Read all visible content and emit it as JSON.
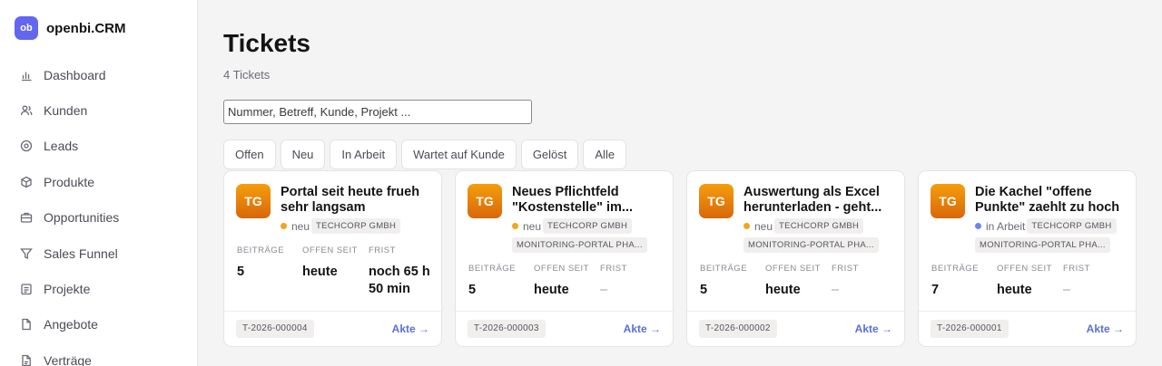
{
  "brand": {
    "logo": "ob",
    "name": "openbi.CRM",
    "color": "#6366f1"
  },
  "nav": [
    {
      "icon": "bar-chart-icon",
      "label": "Dashboard"
    },
    {
      "icon": "users-icon",
      "label": "Kunden"
    },
    {
      "icon": "target-icon",
      "label": "Leads"
    },
    {
      "icon": "box-icon",
      "label": "Produkte"
    },
    {
      "icon": "briefcase-icon",
      "label": "Opportunities"
    },
    {
      "icon": "funnel-icon",
      "label": "Sales Funnel"
    },
    {
      "icon": "clipboard-icon",
      "label": "Projekte"
    },
    {
      "icon": "document-icon",
      "label": "Angebote"
    },
    {
      "icon": "contract-icon",
      "label": "Verträge"
    }
  ],
  "page": {
    "title": "Tickets",
    "count": "4 Tickets"
  },
  "search": {
    "placeholder": "Nummer, Betreff, Kunde, Projekt ..."
  },
  "filters": [
    "Offen",
    "Neu",
    "In Arbeit",
    "Wartet auf Kunde",
    "Gelöst",
    "Alle"
  ],
  "colors": {
    "accent": "#5b6fd6",
    "avatar": "#f59e0b",
    "status_neu": "#f2a51a",
    "status_arbeit": "#6b86e8"
  },
  "labels": {
    "beitraege": "BEITRÄGE",
    "offen_seit": "OFFEN SEIT",
    "frist": "FRIST",
    "akte": "Akte →"
  },
  "tickets": [
    {
      "avatar": "TG",
      "title": "Portal seit heute frueh sehr langsam",
      "status": "neu",
      "customer": "TECHCORP GMBH",
      "project": "",
      "beitraege": "5",
      "offen_seit": "heute",
      "frist": "noch 65 h 50 min",
      "number": "T-2026-000004"
    },
    {
      "avatar": "TG",
      "title": "Neues Pflichtfeld \"Kostenstelle\" im...",
      "status": "neu",
      "customer": "TECHCORP GMBH",
      "project": "MONITORING-PORTAL PHA...",
      "beitraege": "5",
      "offen_seit": "heute",
      "frist": "–",
      "number": "T-2026-000003"
    },
    {
      "avatar": "TG",
      "title": "Auswertung als Excel herunterladen - geht...",
      "status": "neu",
      "customer": "TECHCORP GMBH",
      "project": "MONITORING-PORTAL PHA...",
      "beitraege": "5",
      "offen_seit": "heute",
      "frist": "–",
      "number": "T-2026-000002"
    },
    {
      "avatar": "TG",
      "title": "Die Kachel \"offene Punkte\" zaehlt zu hoch",
      "status": "in Arbeit",
      "customer": "TECHCORP GMBH",
      "project": "MONITORING-PORTAL PHA...",
      "beitraege": "7",
      "offen_seit": "heute",
      "frist": "–",
      "number": "T-2026-000001"
    }
  ]
}
